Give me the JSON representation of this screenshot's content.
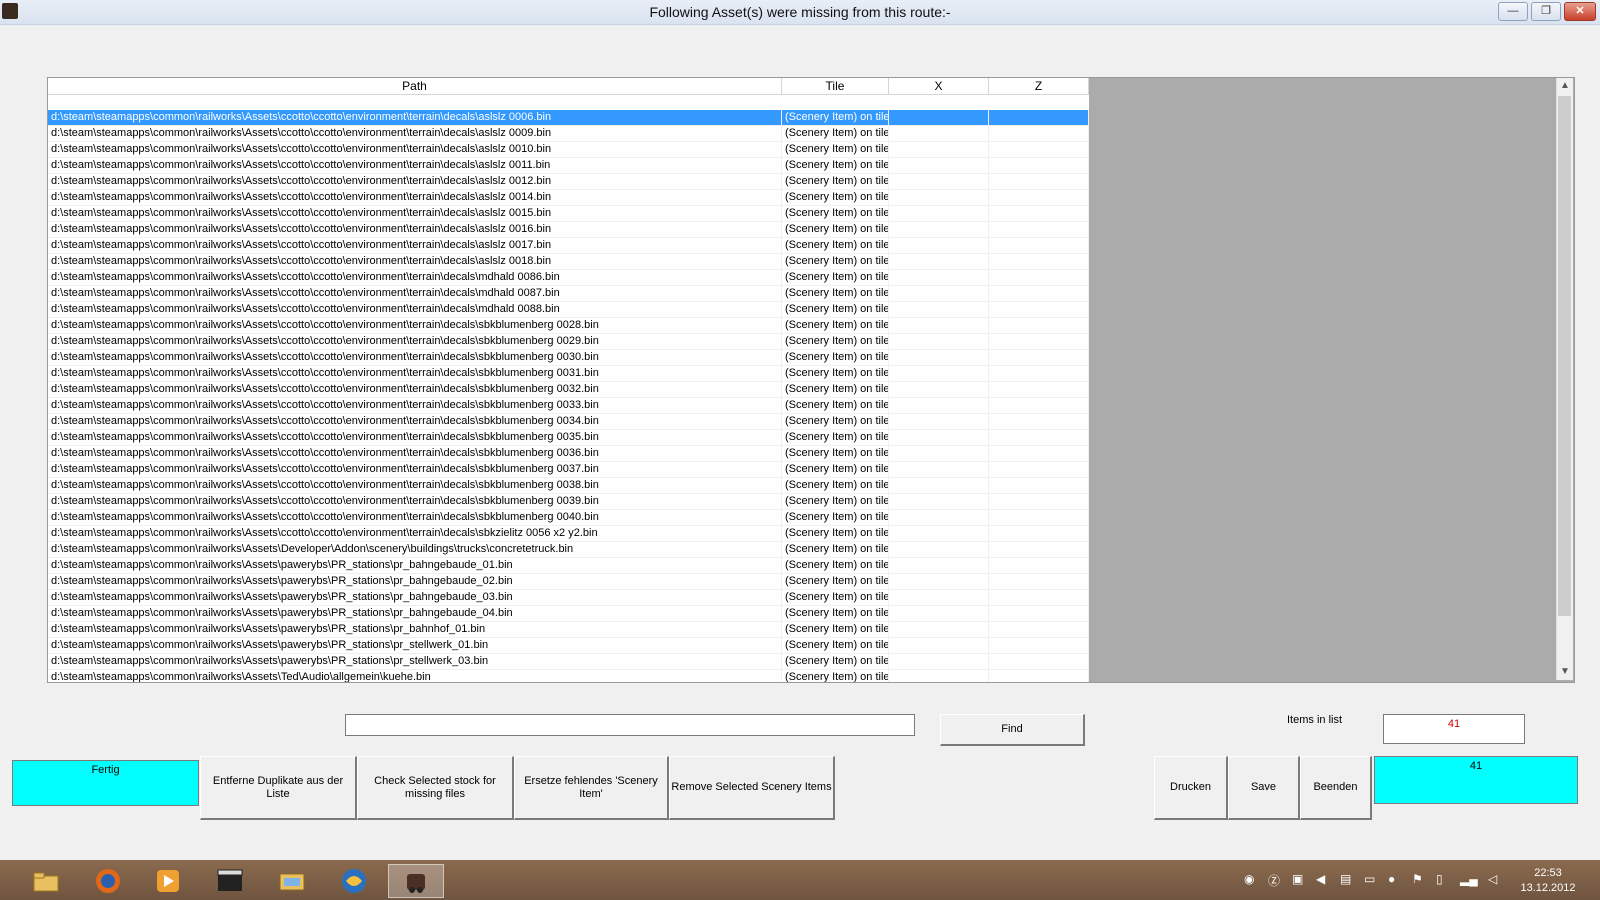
{
  "window": {
    "title": "Following Asset(s) were missing from this route:-",
    "minimize_glyph": "—",
    "restore_glyph": "❐",
    "close_glyph": "✕"
  },
  "table": {
    "columns": [
      "Path",
      "Tile",
      "X",
      "Z"
    ],
    "rows": [
      {
        "path": "d:\\steam\\steamapps\\common\\railworks\\Assets\\ccotto\\ccotto\\environment\\terrain\\decals\\aslslz 0006.bin",
        "tile": "(Scenery Item) on tile",
        "x": "",
        "z": ""
      },
      {
        "path": "d:\\steam\\steamapps\\common\\railworks\\Assets\\ccotto\\ccotto\\environment\\terrain\\decals\\aslslz 0009.bin",
        "tile": "(Scenery Item) on tile",
        "x": "",
        "z": ""
      },
      {
        "path": "d:\\steam\\steamapps\\common\\railworks\\Assets\\ccotto\\ccotto\\environment\\terrain\\decals\\aslslz 0010.bin",
        "tile": "(Scenery Item) on tile",
        "x": "",
        "z": ""
      },
      {
        "path": "d:\\steam\\steamapps\\common\\railworks\\Assets\\ccotto\\ccotto\\environment\\terrain\\decals\\aslslz 0011.bin",
        "tile": "(Scenery Item) on tile",
        "x": "",
        "z": ""
      },
      {
        "path": "d:\\steam\\steamapps\\common\\railworks\\Assets\\ccotto\\ccotto\\environment\\terrain\\decals\\aslslz 0012.bin",
        "tile": "(Scenery Item) on tile",
        "x": "",
        "z": ""
      },
      {
        "path": "d:\\steam\\steamapps\\common\\railworks\\Assets\\ccotto\\ccotto\\environment\\terrain\\decals\\aslslz 0014.bin",
        "tile": "(Scenery Item) on tile",
        "x": "",
        "z": ""
      },
      {
        "path": "d:\\steam\\steamapps\\common\\railworks\\Assets\\ccotto\\ccotto\\environment\\terrain\\decals\\aslslz 0015.bin",
        "tile": "(Scenery Item) on tile",
        "x": "",
        "z": ""
      },
      {
        "path": "d:\\steam\\steamapps\\common\\railworks\\Assets\\ccotto\\ccotto\\environment\\terrain\\decals\\aslslz 0016.bin",
        "tile": "(Scenery Item) on tile",
        "x": "",
        "z": ""
      },
      {
        "path": "d:\\steam\\steamapps\\common\\railworks\\Assets\\ccotto\\ccotto\\environment\\terrain\\decals\\aslslz 0017.bin",
        "tile": "(Scenery Item) on tile",
        "x": "",
        "z": ""
      },
      {
        "path": "d:\\steam\\steamapps\\common\\railworks\\Assets\\ccotto\\ccotto\\environment\\terrain\\decals\\aslslz 0018.bin",
        "tile": "(Scenery Item) on tile",
        "x": "",
        "z": ""
      },
      {
        "path": "d:\\steam\\steamapps\\common\\railworks\\Assets\\ccotto\\ccotto\\environment\\terrain\\decals\\mdhald 0086.bin",
        "tile": "(Scenery Item) on tile",
        "x": "",
        "z": ""
      },
      {
        "path": "d:\\steam\\steamapps\\common\\railworks\\Assets\\ccotto\\ccotto\\environment\\terrain\\decals\\mdhald 0087.bin",
        "tile": "(Scenery Item) on tile",
        "x": "",
        "z": ""
      },
      {
        "path": "d:\\steam\\steamapps\\common\\railworks\\Assets\\ccotto\\ccotto\\environment\\terrain\\decals\\mdhald 0088.bin",
        "tile": "(Scenery Item) on tile",
        "x": "",
        "z": ""
      },
      {
        "path": "d:\\steam\\steamapps\\common\\railworks\\Assets\\ccotto\\ccotto\\environment\\terrain\\decals\\sbkblumenberg 0028.bin",
        "tile": "(Scenery Item) on tile",
        "x": "",
        "z": ""
      },
      {
        "path": "d:\\steam\\steamapps\\common\\railworks\\Assets\\ccotto\\ccotto\\environment\\terrain\\decals\\sbkblumenberg 0029.bin",
        "tile": "(Scenery Item) on tile",
        "x": "",
        "z": ""
      },
      {
        "path": "d:\\steam\\steamapps\\common\\railworks\\Assets\\ccotto\\ccotto\\environment\\terrain\\decals\\sbkblumenberg 0030.bin",
        "tile": "(Scenery Item) on tile",
        "x": "",
        "z": ""
      },
      {
        "path": "d:\\steam\\steamapps\\common\\railworks\\Assets\\ccotto\\ccotto\\environment\\terrain\\decals\\sbkblumenberg 0031.bin",
        "tile": "(Scenery Item) on tile",
        "x": "",
        "z": ""
      },
      {
        "path": "d:\\steam\\steamapps\\common\\railworks\\Assets\\ccotto\\ccotto\\environment\\terrain\\decals\\sbkblumenberg 0032.bin",
        "tile": "(Scenery Item) on tile",
        "x": "",
        "z": ""
      },
      {
        "path": "d:\\steam\\steamapps\\common\\railworks\\Assets\\ccotto\\ccotto\\environment\\terrain\\decals\\sbkblumenberg 0033.bin",
        "tile": "(Scenery Item) on tile",
        "x": "",
        "z": ""
      },
      {
        "path": "d:\\steam\\steamapps\\common\\railworks\\Assets\\ccotto\\ccotto\\environment\\terrain\\decals\\sbkblumenberg 0034.bin",
        "tile": "(Scenery Item) on tile",
        "x": "",
        "z": ""
      },
      {
        "path": "d:\\steam\\steamapps\\common\\railworks\\Assets\\ccotto\\ccotto\\environment\\terrain\\decals\\sbkblumenberg 0035.bin",
        "tile": "(Scenery Item) on tile",
        "x": "",
        "z": ""
      },
      {
        "path": "d:\\steam\\steamapps\\common\\railworks\\Assets\\ccotto\\ccotto\\environment\\terrain\\decals\\sbkblumenberg 0036.bin",
        "tile": "(Scenery Item) on tile",
        "x": "",
        "z": ""
      },
      {
        "path": "d:\\steam\\steamapps\\common\\railworks\\Assets\\ccotto\\ccotto\\environment\\terrain\\decals\\sbkblumenberg 0037.bin",
        "tile": "(Scenery Item) on tile",
        "x": "",
        "z": ""
      },
      {
        "path": "d:\\steam\\steamapps\\common\\railworks\\Assets\\ccotto\\ccotto\\environment\\terrain\\decals\\sbkblumenberg 0038.bin",
        "tile": "(Scenery Item) on tile",
        "x": "",
        "z": ""
      },
      {
        "path": "d:\\steam\\steamapps\\common\\railworks\\Assets\\ccotto\\ccotto\\environment\\terrain\\decals\\sbkblumenberg 0039.bin",
        "tile": "(Scenery Item) on tile",
        "x": "",
        "z": ""
      },
      {
        "path": "d:\\steam\\steamapps\\common\\railworks\\Assets\\ccotto\\ccotto\\environment\\terrain\\decals\\sbkblumenberg 0040.bin",
        "tile": "(Scenery Item) on tile",
        "x": "",
        "z": ""
      },
      {
        "path": "d:\\steam\\steamapps\\common\\railworks\\Assets\\ccotto\\ccotto\\environment\\terrain\\decals\\sbkzielitz 0056 x2 y2.bin",
        "tile": "(Scenery Item) on tile",
        "x": "",
        "z": ""
      },
      {
        "path": "d:\\steam\\steamapps\\common\\railworks\\Assets\\Developer\\Addon\\scenery\\buildings\\trucks\\concretetruck.bin",
        "tile": "(Scenery Item) on tile",
        "x": "",
        "z": ""
      },
      {
        "path": "d:\\steam\\steamapps\\common\\railworks\\Assets\\pawerybs\\PR_stations\\pr_bahngebaude_01.bin",
        "tile": "(Scenery Item) on tile",
        "x": "",
        "z": ""
      },
      {
        "path": "d:\\steam\\steamapps\\common\\railworks\\Assets\\pawerybs\\PR_stations\\pr_bahngebaude_02.bin",
        "tile": "(Scenery Item) on tile",
        "x": "",
        "z": ""
      },
      {
        "path": "d:\\steam\\steamapps\\common\\railworks\\Assets\\pawerybs\\PR_stations\\pr_bahngebaude_03.bin",
        "tile": "(Scenery Item) on tile",
        "x": "",
        "z": ""
      },
      {
        "path": "d:\\steam\\steamapps\\common\\railworks\\Assets\\pawerybs\\PR_stations\\pr_bahngebaude_04.bin",
        "tile": "(Scenery Item) on tile",
        "x": "",
        "z": ""
      },
      {
        "path": "d:\\steam\\steamapps\\common\\railworks\\Assets\\pawerybs\\PR_stations\\pr_bahnhof_01.bin",
        "tile": "(Scenery Item) on tile",
        "x": "",
        "z": ""
      },
      {
        "path": "d:\\steam\\steamapps\\common\\railworks\\Assets\\pawerybs\\PR_stations\\pr_stellwerk_01.bin",
        "tile": "(Scenery Item) on tile",
        "x": "",
        "z": ""
      },
      {
        "path": "d:\\steam\\steamapps\\common\\railworks\\Assets\\pawerybs\\PR_stations\\pr_stellwerk_03.bin",
        "tile": "(Scenery Item) on tile",
        "x": "",
        "z": ""
      },
      {
        "path": "d:\\steam\\steamapps\\common\\railworks\\Assets\\Ted\\Audio\\allgemein\\kuehe.bin",
        "tile": "(Scenery Item) on tile",
        "x": "",
        "z": ""
      }
    ],
    "selected_index": 0
  },
  "find": {
    "value": "",
    "button_label": "Find"
  },
  "items_in_list": {
    "label": "Items in list",
    "value": "41"
  },
  "buttons": {
    "fertig": "Fertig",
    "remove_duplicates": "Entferne Duplikate aus der Liste",
    "check_stock": "Check Selected stock for missing files",
    "replace_missing": "Ersetze fehlendes 'Scenery Item'",
    "remove_selected": "Remove Selected Scenery Items",
    "print": "Drucken",
    "save": "Save",
    "quit": "Beenden"
  },
  "status_count": "41",
  "taskbar": {
    "apps": [
      "folder-icon",
      "firefox-icon",
      "media-player-icon",
      "film-icon",
      "explorer-icon",
      "globe-app-icon",
      "train-app-icon"
    ],
    "tray_icons": [
      "steam-icon",
      "z-icon",
      "network-icon",
      "speaker-icon",
      "printer-icon",
      "display-icon",
      "update-icon",
      "flag-icon",
      "battery-icon",
      "signal-icon",
      "volume-icon"
    ],
    "time": "22:53",
    "date": "13.12.2012"
  },
  "colors": {
    "accent_selection": "#3399ff",
    "status_cyan": "#00ffff",
    "count_text": "#cc0000"
  }
}
